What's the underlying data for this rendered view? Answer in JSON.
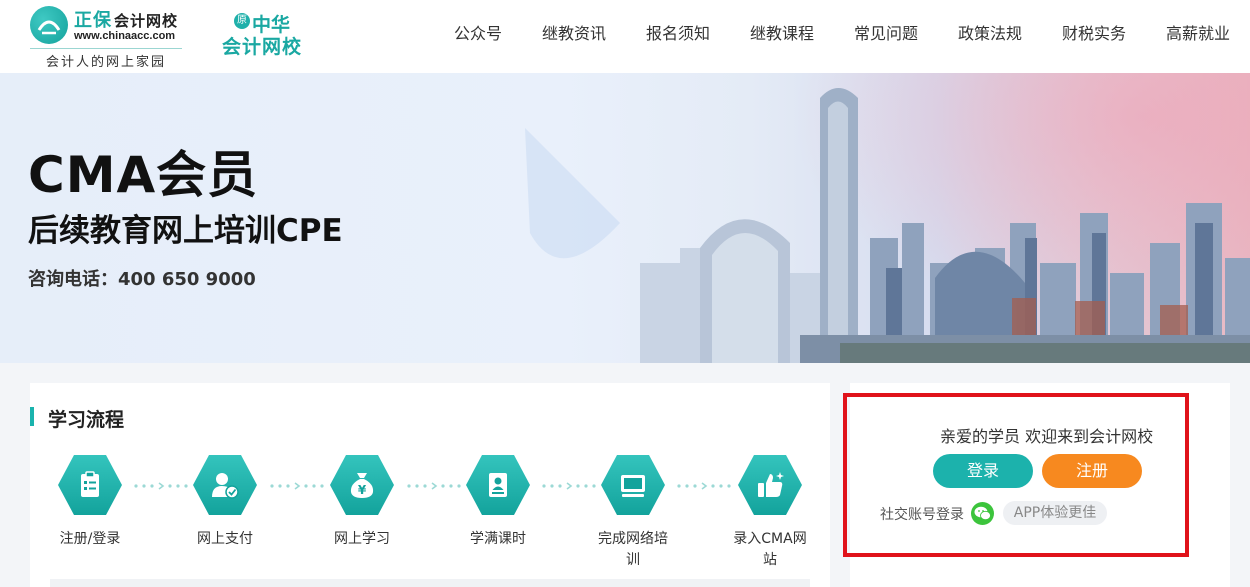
{
  "logo": {
    "brand": "正保",
    "brand_sub": "会计网校",
    "url": "www.chinaacc.com",
    "slogan": "会计人的网上家园",
    "second_badge": "原",
    "second_line1": "中华",
    "second_line2": "会计网校"
  },
  "nav": [
    {
      "label": "公众号"
    },
    {
      "label": "继教资讯"
    },
    {
      "label": "报名须知"
    },
    {
      "label": "继教课程"
    },
    {
      "label": "常见问题"
    },
    {
      "label": "政策法规"
    },
    {
      "label": "财税实务"
    },
    {
      "label": "高薪就业"
    }
  ],
  "banner": {
    "title": "CMA会员",
    "subtitle": "后续教育网上培训CPE",
    "phone": "咨询电话：400  650  9000"
  },
  "process": {
    "title": "学习流程",
    "steps": [
      {
        "label": "注册/登录",
        "icon": "clipboard-icon"
      },
      {
        "label": "网上支付",
        "icon": "user-check-icon"
      },
      {
        "label": "网上学习",
        "icon": "money-bag-icon"
      },
      {
        "label": "学满课时",
        "icon": "document-icon"
      },
      {
        "label": "完成网络培训",
        "icon": "monitor-icon"
      },
      {
        "label": "录入CMA网站",
        "icon": "thumbs-up-icon"
      }
    ]
  },
  "login_panel": {
    "welcome": "亲爱的学员 欢迎来到会计网校",
    "login_button": "登录",
    "register_button": "注册",
    "social_label": "社交账号登录",
    "app_tag": "APP体验更佳"
  },
  "colors": {
    "accent": "#1cb2ac",
    "register": "#f7891f",
    "highlight_box": "#e0121a"
  }
}
